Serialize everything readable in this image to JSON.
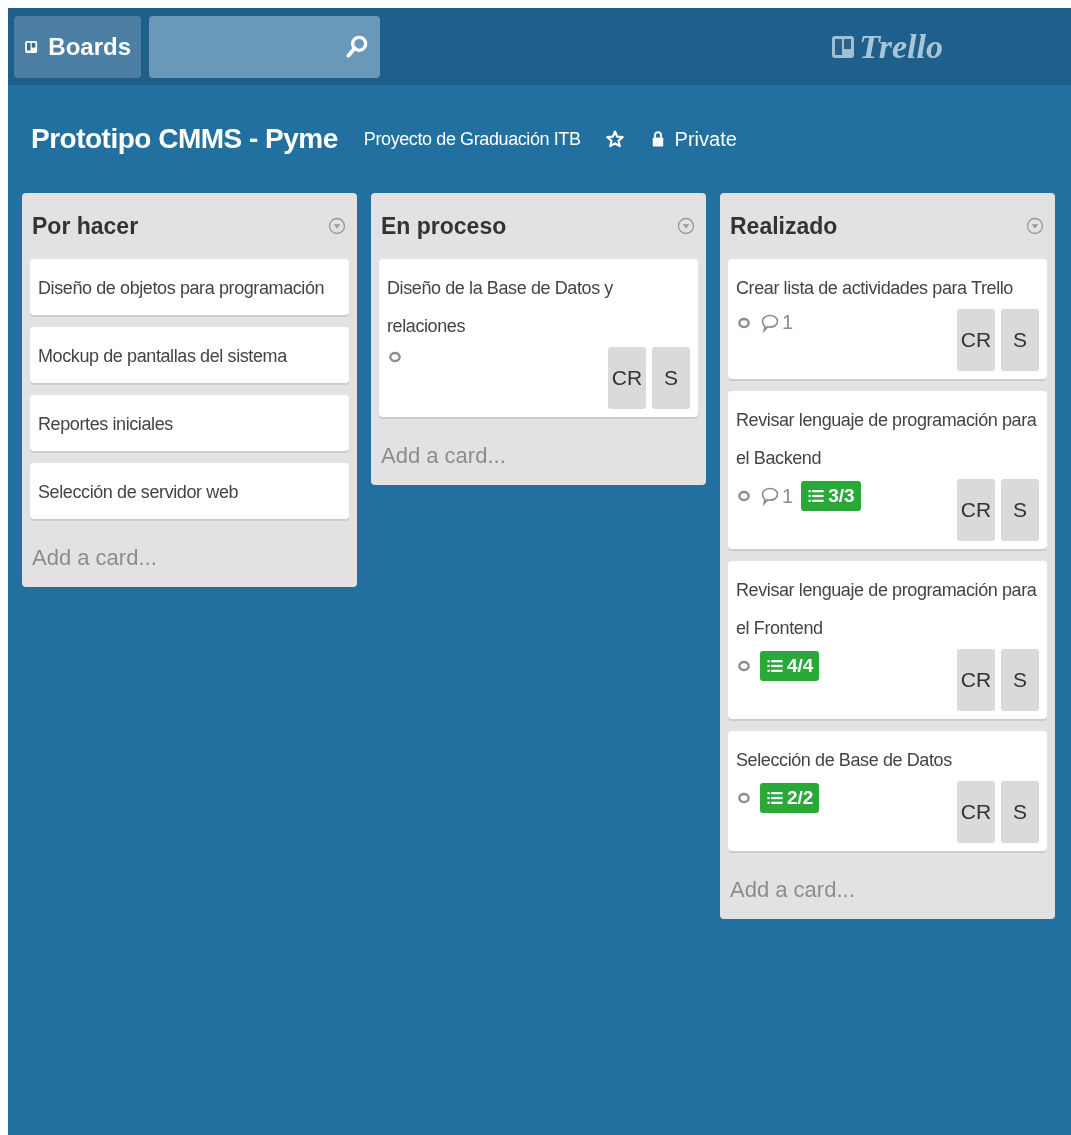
{
  "header": {
    "boards_button": "Boards",
    "logo": "Trello"
  },
  "board": {
    "title": "Prototipo CMMS - Pyme",
    "team": "Proyecto de Graduación ITB",
    "starred": false,
    "visibility": "Private"
  },
  "lists": [
    {
      "title": "Por hacer",
      "add_card": "Add a card...",
      "cards": [
        {
          "title": "Diseño de objetos para programación"
        },
        {
          "title": "Mockup de pantallas del sistema"
        },
        {
          "title": "Reportes iniciales"
        },
        {
          "title": "Selección de servidor web"
        }
      ]
    },
    {
      "title": "En proceso",
      "add_card": "Add a card...",
      "cards": [
        {
          "title": "Diseño de la Base de Datos y relaciones",
          "badges": [
            {
              "kind": "watch"
            }
          ],
          "members": [
            "CR",
            "S"
          ]
        }
      ]
    },
    {
      "title": "Realizado",
      "add_card": "Add a card...",
      "cards": [
        {
          "title": "Crear lista de actividades para Trello",
          "badges": [
            {
              "kind": "watch"
            },
            {
              "kind": "comments",
              "text": "1"
            }
          ],
          "members": [
            "CR",
            "S"
          ]
        },
        {
          "title": "Revisar lenguaje de programación para el Backend",
          "badges": [
            {
              "kind": "watch"
            },
            {
              "kind": "comments",
              "text": "1"
            },
            {
              "kind": "checklist",
              "text": "3/3",
              "complete": true
            }
          ],
          "members": [
            "CR",
            "S"
          ]
        },
        {
          "title": "Revisar lenguaje de programación para el Frontend",
          "badges": [
            {
              "kind": "watch"
            },
            {
              "kind": "checklist",
              "text": "4/4",
              "complete": true
            }
          ],
          "members": [
            "CR",
            "S"
          ]
        },
        {
          "title": "Selección de Base de Datos",
          "badges": [
            {
              "kind": "watch"
            },
            {
              "kind": "checklist",
              "text": "2/2",
              "complete": true
            }
          ],
          "members": [
            "CR",
            "S"
          ]
        }
      ]
    }
  ]
}
